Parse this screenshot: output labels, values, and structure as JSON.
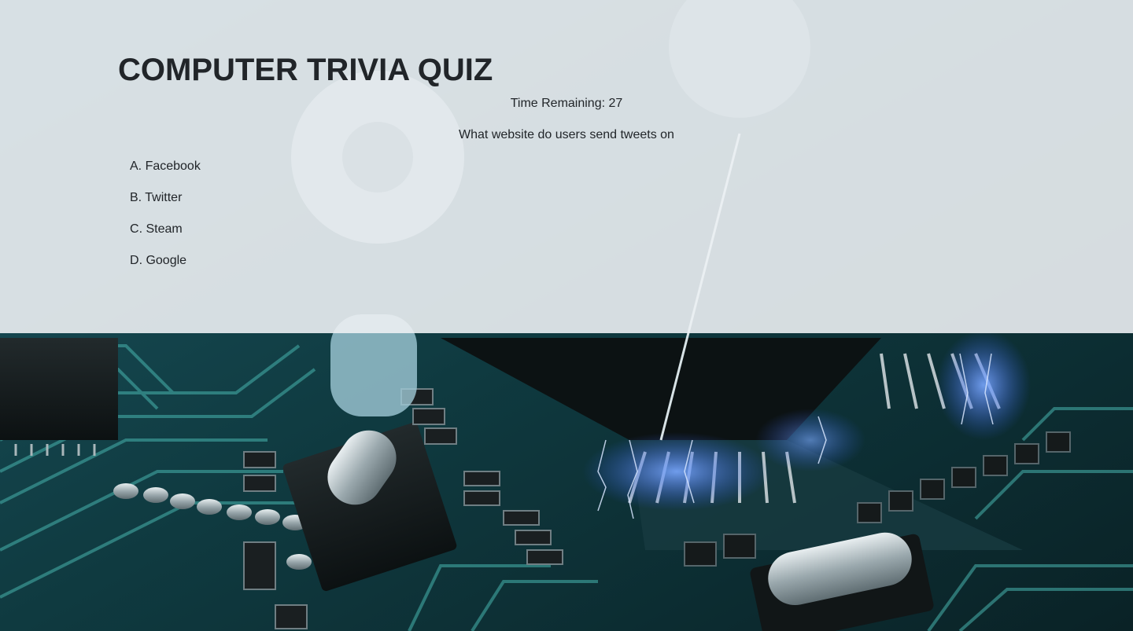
{
  "quiz": {
    "title": "COMPUTER TRIVIA QUIZ",
    "timer_label": "Time Remaining:",
    "time_remaining": 27,
    "question": "What website do users send tweets on",
    "answers": [
      {
        "letter": "A",
        "text": "Facebook"
      },
      {
        "letter": "B",
        "text": "Twitter"
      },
      {
        "letter": "C",
        "text": "Steam"
      },
      {
        "letter": "D",
        "text": "Google"
      }
    ]
  },
  "colors": {
    "panel": "#eceff3",
    "text": "#212529",
    "board": "#0f2a30",
    "trace": "#3fa9a6",
    "glow": "#4a7dff"
  }
}
